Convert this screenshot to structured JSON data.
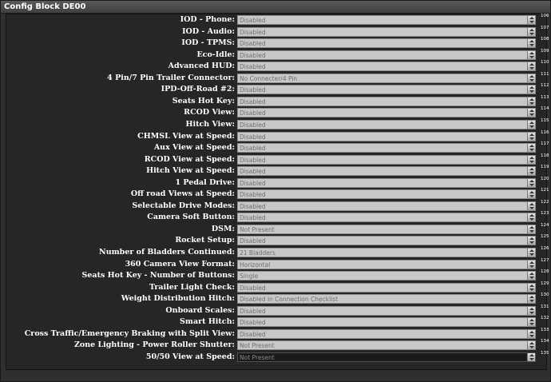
{
  "window": {
    "title": "Config Block DE00"
  },
  "rows": [
    {
      "label": "IOD - Phone:",
      "value": "Disabled",
      "index": "106"
    },
    {
      "label": "IOD - Audio:",
      "value": "Disabled",
      "index": "107"
    },
    {
      "label": "IOD - TPMS:",
      "value": "Disabled",
      "index": "108"
    },
    {
      "label": "Eco-Idle:",
      "value": "Disabled",
      "index": "109"
    },
    {
      "label": "Advanced HUD:",
      "value": "Disabled",
      "index": "110"
    },
    {
      "label": "4 Pin/7 Pin Trailer Connector:",
      "value": "No Connecter/4 Pin",
      "index": "111"
    },
    {
      "label": "IPD-Off-Road #2:",
      "value": "Disabled",
      "index": "112"
    },
    {
      "label": "Seats Hot Key:",
      "value": "Disabled",
      "index": "113"
    },
    {
      "label": "RCOD View:",
      "value": "Disabled",
      "index": "114"
    },
    {
      "label": "Hitch View:",
      "value": "Disabled",
      "index": "115"
    },
    {
      "label": "CHMSL View at Speed:",
      "value": "Disabled",
      "index": "116"
    },
    {
      "label": "Aux View at Speed:",
      "value": "Disabled",
      "index": "117"
    },
    {
      "label": "RCOD View at Speed:",
      "value": "Disabled",
      "index": "118"
    },
    {
      "label": "Hitch View at Speed:",
      "value": "Disabled",
      "index": "119"
    },
    {
      "label": "1 Pedal Drive:",
      "value": "Disabled",
      "index": "120"
    },
    {
      "label": "Off road Views at Speed:",
      "value": "Disabled",
      "index": "121"
    },
    {
      "label": "Selectable Drive Modes:",
      "value": "Disabled",
      "index": "122"
    },
    {
      "label": "Camera Soft Button:",
      "value": "Disabled",
      "index": "123"
    },
    {
      "label": "DSM:",
      "value": "Not Present",
      "index": "124"
    },
    {
      "label": "Rocket Setup:",
      "value": "Disabled",
      "index": "125"
    },
    {
      "label": "Number of Bladders Continued:",
      "value": "21 Bladders",
      "index": "126"
    },
    {
      "label": "360 Camera View Format:",
      "value": "Horizontal",
      "index": "127"
    },
    {
      "label": "Seats Hot Key - Number of Buttons:",
      "value": "Single",
      "index": "128"
    },
    {
      "label": "Trailer Light Check:",
      "value": "Disabled",
      "index": "129"
    },
    {
      "label": "Weight Distribution Hitch:",
      "value": "Disabled in Connection Checklist",
      "index": "130"
    },
    {
      "label": "Onboard Scales:",
      "value": "Disabled",
      "index": "131"
    },
    {
      "label": "Smart Hitch:",
      "value": "Disabled",
      "index": "132"
    },
    {
      "label": "Cross Traffic/Emergency Braking with Split View:",
      "value": "Disabled",
      "index": "133"
    },
    {
      "label": "Zone Lighting - Power Roller Shutter:",
      "value": "Not Present",
      "index": "134"
    },
    {
      "label": "50/50 View at Speed:",
      "value": "Not Present",
      "index": "135"
    }
  ]
}
